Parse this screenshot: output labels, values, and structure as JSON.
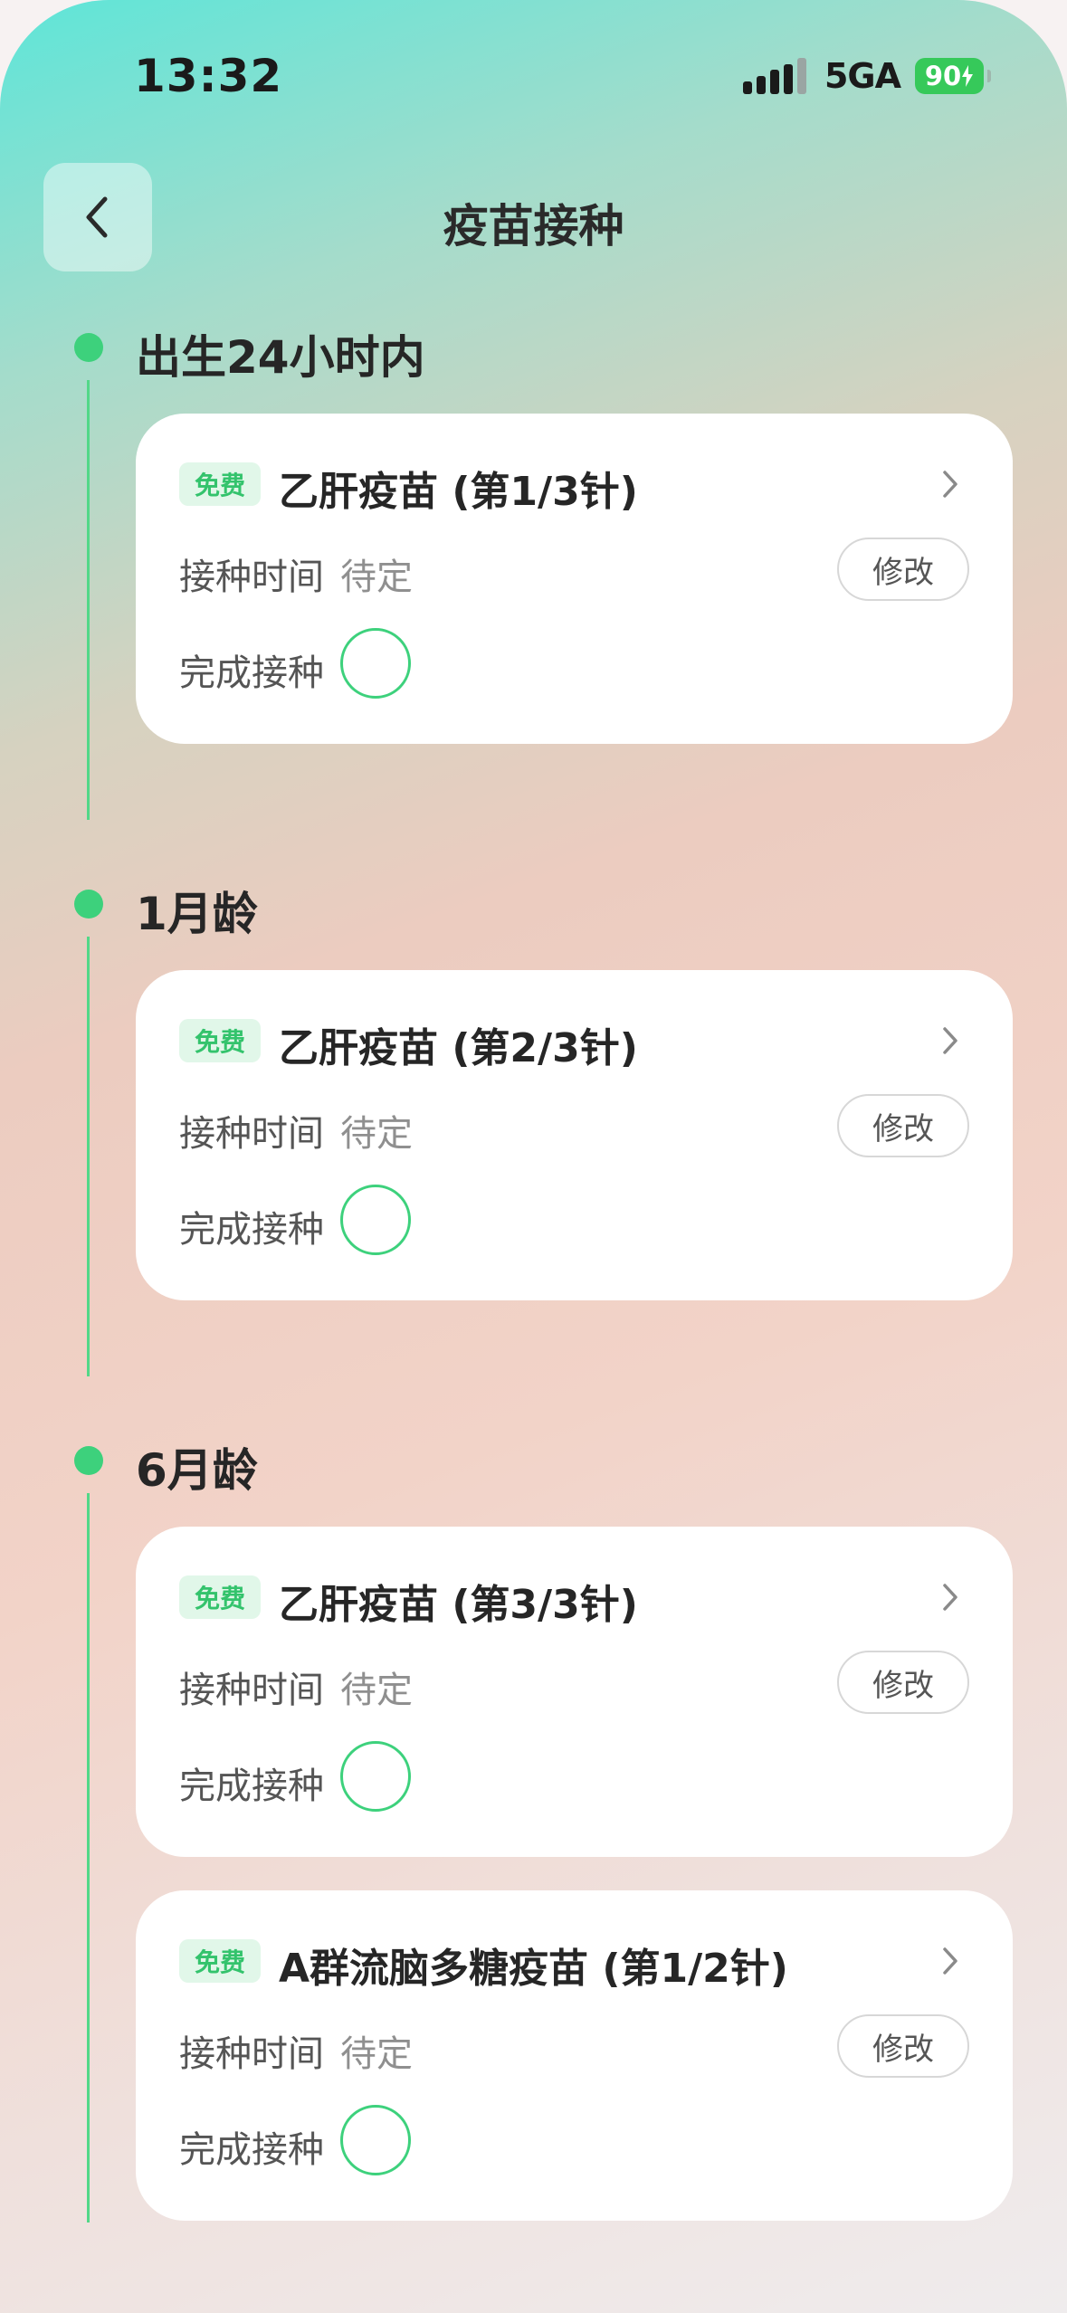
{
  "status_bar": {
    "time": "13:32",
    "network": "5GA",
    "battery": "90"
  },
  "header": {
    "title": "疫苗接种",
    "back_icon": "chevron-left-icon"
  },
  "sections": [
    {
      "label": "出生24小时内",
      "cards": [
        {
          "badge": "免费",
          "name": "乙肝疫苗 (第1/3针)",
          "date_label": "接种时间",
          "date_value": "待定",
          "modify_label": "修改",
          "done_label": "完成接种"
        }
      ]
    },
    {
      "label": "1月龄",
      "cards": [
        {
          "badge": "免费",
          "name": "乙肝疫苗 (第2/3针)",
          "date_label": "接种时间",
          "date_value": "待定",
          "modify_label": "修改",
          "done_label": "完成接种"
        }
      ]
    },
    {
      "label": "6月龄",
      "cards": [
        {
          "badge": "免费",
          "name": "乙肝疫苗 (第3/3针)",
          "date_label": "接种时间",
          "date_value": "待定",
          "modify_label": "修改",
          "done_label": "完成接种"
        },
        {
          "badge": "免费",
          "name": "A群流脑多糖疫苗 (第1/2针)",
          "date_label": "接种时间",
          "date_value": "待定",
          "modify_label": "修改",
          "done_label": "完成接种"
        }
      ]
    }
  ],
  "colors": {
    "accent_green": "#3dd17c",
    "badge_bg": "#e1f7e9",
    "battery_green": "#36c95a"
  }
}
